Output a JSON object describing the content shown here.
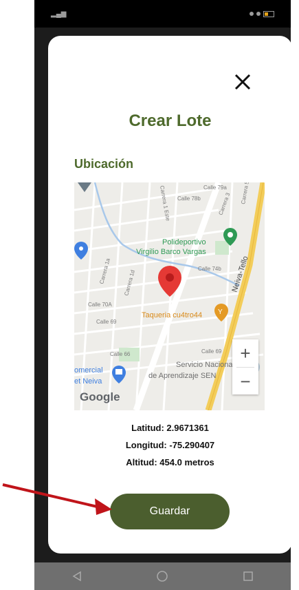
{
  "modal": {
    "title": "Crear Lote",
    "section_label": "Ubicación",
    "close_icon": "close-icon"
  },
  "map": {
    "street_labels": [
      "Calle 79a",
      "Calle 78b",
      "Carrera 3",
      "Carrera 1 Este",
      "Carrera 5",
      "Calle 74b",
      "Calle 70A",
      "Calle 69",
      "Calle 66",
      "Calle 69",
      "Carrera 1a",
      "Carrera 1d",
      "Neiva-Tello"
    ],
    "places": {
      "poi_1a": "Polideportivo",
      "poi_1b": "Virgilio Barco Vargas",
      "poi_2": "Taqueria cu4tro44",
      "poi_3a": "Servicio Nacional",
      "poi_3b": "de Aprendizaje SEN",
      "poi_4a": "omercial",
      "poi_4b": "et Neiva"
    },
    "attribution": "Google",
    "zoom_in": "+",
    "zoom_out": "−"
  },
  "coords": {
    "latitude": "Latitud: 2.9671361",
    "longitude": "Longitud: -75.290407",
    "altitude": "Altitud: 454.0 metros"
  },
  "save_button": {
    "label": "Guardar"
  },
  "colors": {
    "accent": "#4e6a2c",
    "button": "#4b5e2e",
    "marker": "#e53935",
    "arrow": "#c0141a"
  }
}
